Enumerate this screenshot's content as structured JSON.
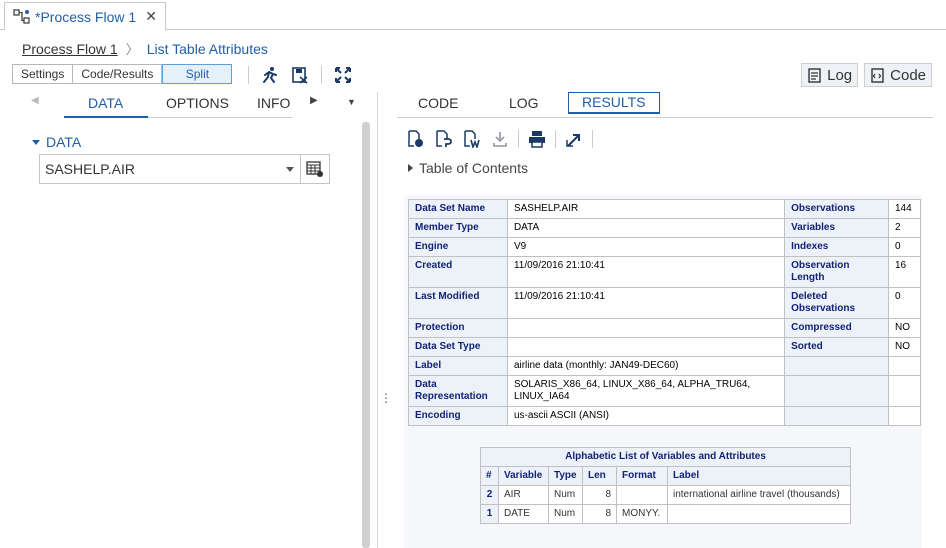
{
  "tab": {
    "title": "*Process Flow 1",
    "close": "✕"
  },
  "breadcrumb": {
    "parent": "Process Flow 1",
    "separator": "〉",
    "current": "List Table Attributes"
  },
  "view_toggle": {
    "settings": "Settings",
    "code_results": "Code/Results",
    "split": "Split"
  },
  "right_buttons": {
    "log": "Log",
    "code": "Code"
  },
  "left_tabs": [
    {
      "label": "DATA",
      "active": true
    },
    {
      "label": "OPTIONS"
    },
    {
      "label": "INFO"
    }
  ],
  "data_section": {
    "heading": "DATA",
    "dataset_value": "SASHELP.AIR"
  },
  "right_tabs": [
    {
      "label": "CODE"
    },
    {
      "label": "LOG"
    },
    {
      "label": "RESULTS",
      "active": true
    }
  ],
  "toc_label": "Table of Contents",
  "attributes": {
    "rows": [
      {
        "k1": "Data Set Name",
        "v1": "SASHELP.AIR",
        "k2": "Observations",
        "v2": "144"
      },
      {
        "k1": "Member Type",
        "v1": "DATA",
        "k2": "Variables",
        "v2": "2"
      },
      {
        "k1": "Engine",
        "v1": "V9",
        "k2": "Indexes",
        "v2": "0"
      },
      {
        "k1": "Created",
        "v1": "11/09/2016 21:10:41",
        "k2": "Observation Length",
        "v2": "16"
      },
      {
        "k1": "Last Modified",
        "v1": "11/09/2016 21:10:41",
        "k2": "Deleted Observations",
        "v2": "0"
      },
      {
        "k1": "Protection",
        "v1": "",
        "k2": "Compressed",
        "v2": "NO"
      },
      {
        "k1": "Data Set Type",
        "v1": "",
        "k2": "Sorted",
        "v2": "NO"
      },
      {
        "k1": "Label",
        "v1": "airline data (monthly: JAN49-DEC60)",
        "k2": "",
        "v2": ""
      },
      {
        "k1": "Data Representation",
        "v1": "SOLARIS_X86_64, LINUX_X86_64, ALPHA_TRU64, LINUX_IA64",
        "k2": "",
        "v2": ""
      },
      {
        "k1": "Encoding",
        "v1": "us-ascii ASCII (ANSI)",
        "k2": "",
        "v2": ""
      }
    ]
  },
  "variables": {
    "caption": "Alphabetic List of Variables and Attributes",
    "headers": [
      "#",
      "Variable",
      "Type",
      "Len",
      "Format",
      "Label"
    ],
    "rows": [
      {
        "n": "2",
        "var": "AIR",
        "type": "Num",
        "len": "8",
        "format": "",
        "label": "international airline travel (thousands)"
      },
      {
        "n": "1",
        "var": "DATE",
        "type": "Num",
        "len": "8",
        "format": "MONYY.",
        "label": ""
      }
    ]
  }
}
